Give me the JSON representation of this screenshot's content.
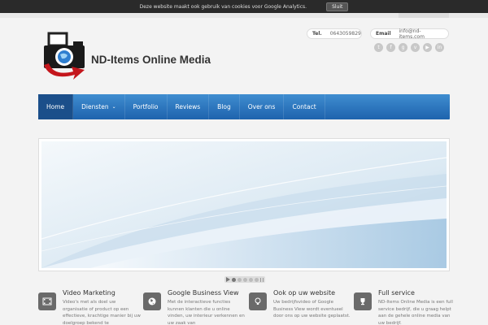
{
  "cookie": {
    "text": "Deze website maakt ook gebruik van cookies voor Google Analytics.",
    "button": "Sluit"
  },
  "brand": {
    "title": "ND-Items Online Media",
    "colors": {
      "red": "#c4161c",
      "blue": "#1e63ad",
      "dark": "#222222"
    }
  },
  "contact": {
    "tel_label": "Tel.",
    "tel_value": "0643059829",
    "email_label": "Email",
    "email_value": "info@nd-items.com"
  },
  "socials": [
    "twitter-icon",
    "facebook-icon",
    "google-plus-icon",
    "vimeo-icon",
    "youtube-icon",
    "linkedin-icon"
  ],
  "nav": {
    "items": [
      {
        "label": "Home",
        "active": true
      },
      {
        "label": "Diensten",
        "has_dropdown": true
      },
      {
        "label": "Portfolio"
      },
      {
        "label": "Reviews"
      },
      {
        "label": "Blog"
      },
      {
        "label": "Over ons"
      },
      {
        "label": "Contact"
      }
    ]
  },
  "features": [
    {
      "icon": "film-icon",
      "title": "Video Marketing",
      "text": "Video's met als doel uw organisatie of product op een effectieve, krachtige manier bij uw doelgroep bekend te"
    },
    {
      "icon": "globe-icon",
      "title": "Google Business View",
      "text": "Met de interactieve functies kunnen klanten die u online vinden, uw interieur verkennen en uw zaak van"
    },
    {
      "icon": "lightbulb-icon",
      "title": "Ook op uw website",
      "text": "Uw bedrijfsvideo of Google Business View wordt eventueel door ons op uw website geplaatst."
    },
    {
      "icon": "trophy-icon",
      "title": "Full service",
      "text": "ND-Items Online Media is een full service bedrijf, die u graag helpt aan de gehele online media van uw bedrijf."
    }
  ]
}
